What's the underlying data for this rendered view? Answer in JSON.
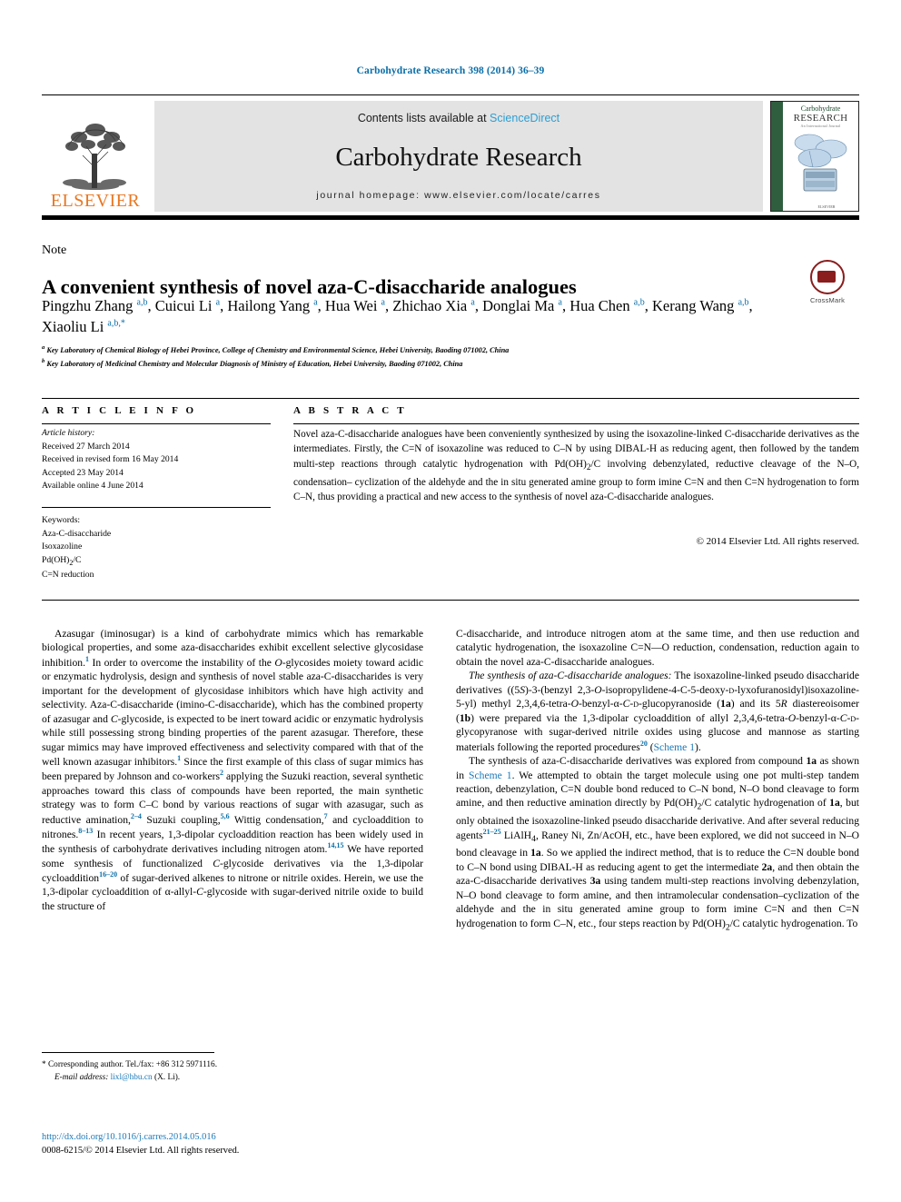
{
  "running_head": "Carbohydrate Research 398 (2014) 36–39",
  "masthead": {
    "contents_prefix": "Contents lists available at ",
    "sciencedirect": "ScienceDirect",
    "journal_title": "Carbohydrate Research",
    "homepage": "journal homepage: www.elsevier.com/locate/carres",
    "publisher_logo_text": "ELSEVIER",
    "cover": {
      "line1": "Carbohydrate",
      "line2": "RESEARCH",
      "sub": "An International Journal",
      "bottom": "ELSEVIER"
    }
  },
  "article": {
    "type_label": "Note",
    "title": "A convenient synthesis of novel aza-C-disaccharide analogues",
    "crossmark_label": "CrossMark",
    "authors_html": "Pingzhu Zhang <sup>a,b</sup>, Cuicui Li <sup>a</sup>, Hailong Yang <sup>a</sup>, Hua Wei <sup>a</sup>, Zhichao Xia <sup>a</sup>, Donglai Ma <sup>a</sup>, Hua Chen <sup>a,b</sup>, Kerang Wang <sup>a,b</sup>, Xiaoliu Li <sup>a,b,</sup><sup>*</sup>",
    "affiliations_html": "<sup>a</sup> Key Laboratory of Chemical Biology of Hebei Province, College of Chemistry and Environmental Science, Hebei University, Baoding 071002, China<br><sup>b</sup> Key Laboratory of Medicinal Chemistry and Molecular Diagnosis of Ministry of Education, Hebei University, Baoding 071002, China"
  },
  "article_info": {
    "heading": "A R T I C L E    I N F O",
    "history_label": "Article history:",
    "history": [
      "Received 27 March 2014",
      "Received in revised form 16 May 2014",
      "Accepted 23 May 2014",
      "Available online 4 June 2014"
    ],
    "keywords_label": "Keywords:",
    "keywords": [
      "Aza-C-disaccharide",
      "Isoxazoline",
      "Pd(OH)2/C",
      "C=N reduction"
    ]
  },
  "abstract": {
    "heading": "A B S T R A C T",
    "text": "Novel aza-C-disaccharide analogues have been conveniently synthesized by using the isoxazoline-linked C-disaccharide derivatives as the intermediates. Firstly, the C=N of isoxazoline was reduced to C–N by using DIBAL-H as reducing agent, then followed by the tandem multi-step reactions through catalytic hydrogenation with Pd(OH)2/C involving debenzylated, reductive cleavage of the N–O, condensation–cyclization of the aldehyde and the in situ generated amine group to form imine C=N and then C=N hydrogenation to form C–N, thus providing a practical and new access to the synthesis of novel aza-C-disaccharide analogues.",
    "copyright": "© 2014 Elsevier Ltd. All rights reserved."
  },
  "body": {
    "left_paragraphs_html": [
      "Azasugar (iminosugar) is a kind of carbohydrate mimics which has remarkable biological properties, and some aza-disaccharides exhibit excellent selective glycosidase inhibition.<sup class=\"ref\">1</sup> In order to overcome the instability of the <span class=\"ital\">O</span>-glycosides moiety toward acidic or enzymatic hydrolysis, design and synthesis of novel stable aza-C-disaccharides is very important for the development of glycosidase inhibitors which have high activity and selectivity. Aza-C-disaccharide (imino-C-disaccharide), which has the combined property of azasugar and <span class=\"ital\">C</span>-glycoside, is expected to be inert toward acidic or enzymatic hydrolysis while still possessing strong binding properties of the parent azasugar. Therefore, these sugar mimics may have improved effectiveness and selectivity compared with that of the well known azasugar inhibitors.<sup class=\"ref\">1</sup> Since the first example of this class of sugar mimics has been prepared by Johnson and co-workers<sup class=\"ref\">2</sup> applying the Suzuki reaction, several synthetic approaches toward this class of compounds have been reported, the main synthetic strategy was to form C–C bond by various reactions of sugar with azasugar, such as reductive amination,<sup class=\"ref\">2–4</sup> Suzuki coupling,<sup class=\"ref\">5,6</sup> Wittig condensation,<sup class=\"ref\">7</sup> and cycloaddition to nitrones.<sup class=\"ref\">8–13</sup> In recent years, 1,3-dipolar cycloaddition reaction has been widely used in the synthesis of carbohydrate derivatives including nitrogen atom.<sup class=\"ref\">14,15</sup> We have reported some synthesis of functionalized <span class=\"ital\">C</span>-glycoside derivatives via the 1,3-dipolar cycloaddition<sup class=\"ref\">16–20</sup> of sugar-derived alkenes to nitrone or nitrile oxides. Herein, we use the 1,3-dipolar cycloaddition of &alpha;-allyl-<span class=\"ital\">C</span>-glycoside with sugar-derived nitrile oxide to build the structure of"
    ],
    "right_paragraphs_html": [
      "C-disaccharide, and introduce nitrogen atom at the same time, and then use reduction and catalytic hydrogenation, the isoxazoline C=N—O reduction, condensation, reduction again to obtain the novel aza-C-disaccharide analogues.",
      "<span class=\"ital\">The synthesis of aza-C-disaccharide analogues:</span> The isoxazoline-linked pseudo disaccharide derivatives ((5<span class=\"ital\">S</span>)-3-(benzyl 2,3-<span class=\"ital\">O</span>-isopropylidene-4-C-5-deoxy-<span style=\"font-variant:small-caps\">d</span>-lyxofuranosidyl)isoxazoline-5-yl) methyl 2,3,4,6-tetra-<span class=\"ital\">O</span>-benzyl-&alpha;-<span class=\"ital\">C</span>-<span style=\"font-variant:small-caps\">d</span>-glucopyranoside (<b>1a</b>) and its 5<span class=\"ital\">R</span> diastereoisomer (<b>1b</b>) were prepared via the 1,3-dipolar cycloaddition of allyl 2,3,4,6-tetra-<span class=\"ital\">O</span>-benzyl-&alpha;-<span class=\"ital\">C</span>-<span style=\"font-variant:small-caps\">d</span>-glycopyranose with sugar-derived nitrile oxides using glucose and mannose as starting materials following the reported procedures<sup class=\"ref\">20</sup> (<span class=\"lnk\">Scheme 1</span>).",
      "The synthesis of aza-C-disaccharide derivatives was explored from compound <b>1a</b> as shown in <span class=\"lnk\">Scheme 1</span>. We attempted to obtain the target molecule using one pot multi-step tandem reaction, debenzylation, C=N double bond reduced to C–N bond, N–O bond cleavage to form amine, and then reductive amination directly by Pd(OH)<sub>2</sub>/C catalytic hydrogenation of <b>1a</b>, but only obtained the isoxazoline-linked pseudo disaccharide derivative. And after several reducing agents<sup class=\"ref\">21–25</sup> LiAlH<sub>4</sub>, Raney Ni, Zn/AcOH, etc., have been explored, we did not succeed in N–O bond cleavage in <b>1a</b>. So we applied the indirect method, that is to reduce the C=N double bond to C–N bond using DIBAL-H as reducing agent to get the intermediate <b>2a</b>, and then obtain the aza-C-disaccharide derivatives <b>3a</b> using tandem multi-step reactions involving debenzylation, N–O bond cleavage to form amine, and then intramolecular condensation–cyclization of the aldehyde and the in situ generated amine group to form imine C=N and then C=N hydrogenation to form C–N, etc., four steps reaction by Pd(OH)<sub>2</sub>/C catalytic hydrogenation. To"
    ]
  },
  "footnote": {
    "marker": "*",
    "corresponding": "Corresponding author. Tel./fax: +86 312 5971116.",
    "email_label": "E-mail address:",
    "email": "lixl@hbu.cn",
    "email_suffix": "(X. Li)."
  },
  "footer": {
    "doi": "http://dx.doi.org/10.1016/j.carres.2014.05.016",
    "issn_line": "0008-6215/© 2014 Elsevier Ltd. All rights reserved."
  },
  "colors": {
    "link": "#1b79b8",
    "running_head": "#0a6ea8",
    "elsevier_orange": "#e87722",
    "sciencedirect": "#2b9fd4",
    "crossmark_red": "#8a1d1d"
  }
}
